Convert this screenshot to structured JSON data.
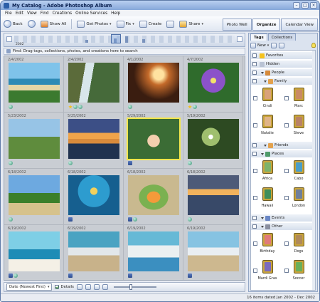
{
  "window": {
    "title": "My Catalog - Adobe Photoshop Album"
  },
  "menu": [
    "File",
    "Edit",
    "View",
    "Find",
    "Creations",
    "Online Services",
    "Help"
  ],
  "toolbar": {
    "back": "Back",
    "show_all": "Show All",
    "get_photos": "Get Photos",
    "fix": "Fix",
    "create": "Create",
    "share": "Share"
  },
  "modes": [
    "Photo Well",
    "Organize",
    "Calendar View"
  ],
  "timeline": {
    "left_label": "2002"
  },
  "findbar": {
    "text": "Find: Drag tags, collections, photos, and creations here to search"
  },
  "photos": [
    {
      "date": "2/4/2002",
      "icons": [
        "g"
      ]
    },
    {
      "date": "2/4/2002",
      "icons": [
        "s",
        "g",
        "g"
      ]
    },
    {
      "date": "4/1/2002",
      "icons": [
        "g"
      ]
    },
    {
      "date": "4/7/2002",
      "icons": [
        "s",
        "g"
      ]
    },
    {
      "date": "5/23/2002",
      "icons": [
        "g"
      ]
    },
    {
      "date": "5/25/2002",
      "icons": [
        "g"
      ]
    },
    {
      "date": "5/29/2002",
      "icons": [
        "t"
      ]
    },
    {
      "date": "5/19/2002",
      "icons": [
        "g"
      ]
    },
    {
      "date": "6/18/2002",
      "icons": [
        "g"
      ]
    },
    {
      "date": "6/18/2002",
      "icons": [
        "t"
      ]
    },
    {
      "date": "6/18/2002",
      "icons": [
        "t",
        "g"
      ]
    },
    {
      "date": "6/18/2002",
      "icons": [
        "g"
      ]
    },
    {
      "date": "6/19/2002",
      "icons": [
        "t",
        "g"
      ]
    },
    {
      "date": "6/19/2002",
      "icons": [
        "t"
      ]
    },
    {
      "date": "6/19/2002",
      "icons": [
        "t"
      ]
    },
    {
      "date": "6/19/2002",
      "icons": [
        "t"
      ]
    }
  ],
  "bottombar": {
    "sort": "Date (Newest First)",
    "details": "Details"
  },
  "status": "16 items dated Jan 2002 - Dec 2002",
  "panel": {
    "tabs": [
      "Tags",
      "Collections"
    ],
    "new": "New",
    "categories": {
      "favorites": "Favorites",
      "hidden": "Hidden",
      "people": "People",
      "family": "Family",
      "friends": "Friends",
      "places": "Places",
      "events": "Events",
      "other": "Other"
    },
    "family_tags": [
      "Cindi",
      "Marc",
      "Natalie",
      "Steve"
    ],
    "place_tags": [
      "Africa",
      "Cabo",
      "Hawaii",
      "London"
    ],
    "other_tags": [
      "Birthday",
      "Dogs",
      "Mardi Gras",
      "Soccer"
    ]
  }
}
